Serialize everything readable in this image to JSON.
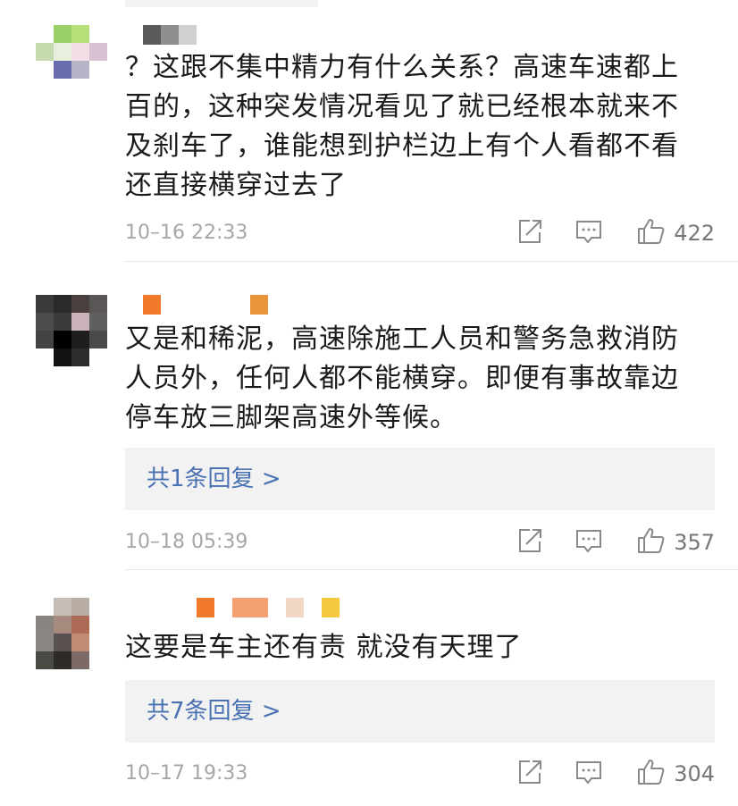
{
  "comments": [
    {
      "text": "？这跟不集中精力有什么关系？高速车速都上百的，这种突发情况看见了就已经根本就来不及刹车了，谁能想到护栏边上有个人看都不看还直接横穿过去了",
      "time": "10–16 22:33",
      "likes": "422",
      "avatar_colors": [
        "#ffffff",
        "#9bcf67",
        "#b8e07a",
        "#ffffff",
        "#c7d9ae",
        "#e6f0dc",
        "#f3dfe8",
        "#d8c1d1",
        "#ffffff",
        "#6a6cb0",
        "#b8b4c8",
        "#ffffff",
        "#ffffff",
        "#ffffff",
        "#ffffff",
        "#ffffff"
      ],
      "name_colors": [
        "#5a5a5a",
        "#8e8e8e",
        "#d0d0d0"
      ]
    },
    {
      "text": "又是和稀泥，高速除施工人员和警务急救消防人员外，任何人都不能横穿。即便有事故靠边停车放三脚架高速外等候。",
      "reply_label": "共1条回复 >",
      "time": "10–18 05:39",
      "likes": "357",
      "avatar_colors": [
        "#3a3a3a",
        "#2a2a2a",
        "#4a4040",
        "#5a5656",
        "#4d4d4d",
        "#3b3b3b",
        "#c9b3b8",
        "#5f5f5f",
        "#444444",
        "#000000",
        "#1e1e1e",
        "#4a4a4a",
        "#ffffff",
        "#111111",
        "#2c2c2c",
        "#ffffff"
      ],
      "name_colors": [
        "#f07a2a",
        "#e8953c"
      ]
    },
    {
      "text": "这要是车主还有责 就没有天理了",
      "reply_label": "共7条回复 >",
      "time": "10–17 19:33",
      "likes": "304",
      "avatar_colors": [
        "#ffffff",
        "#c4beb6",
        "#b9aea3",
        "#ffffff",
        "#8a8480",
        "#a78a7e",
        "#ad6a54",
        "#ffffff",
        "#8b8682",
        "#5a5250",
        "#c18a72",
        "#ffffff",
        "#4a4a44",
        "#2e2a28",
        "#7b6a66",
        "#ffffff"
      ],
      "name_colors": [
        "#f07a2a",
        "#f5a070",
        "#f2d7c5",
        "#f5c840"
      ]
    }
  ],
  "icons": {
    "share": "share-icon",
    "comment": "comment-icon",
    "like": "like-icon"
  },
  "colors": {
    "link": "#4a72b3",
    "meta": "#a6a6a6",
    "text": "#1a1a1a",
    "reply_bg": "#f2f2f2"
  }
}
